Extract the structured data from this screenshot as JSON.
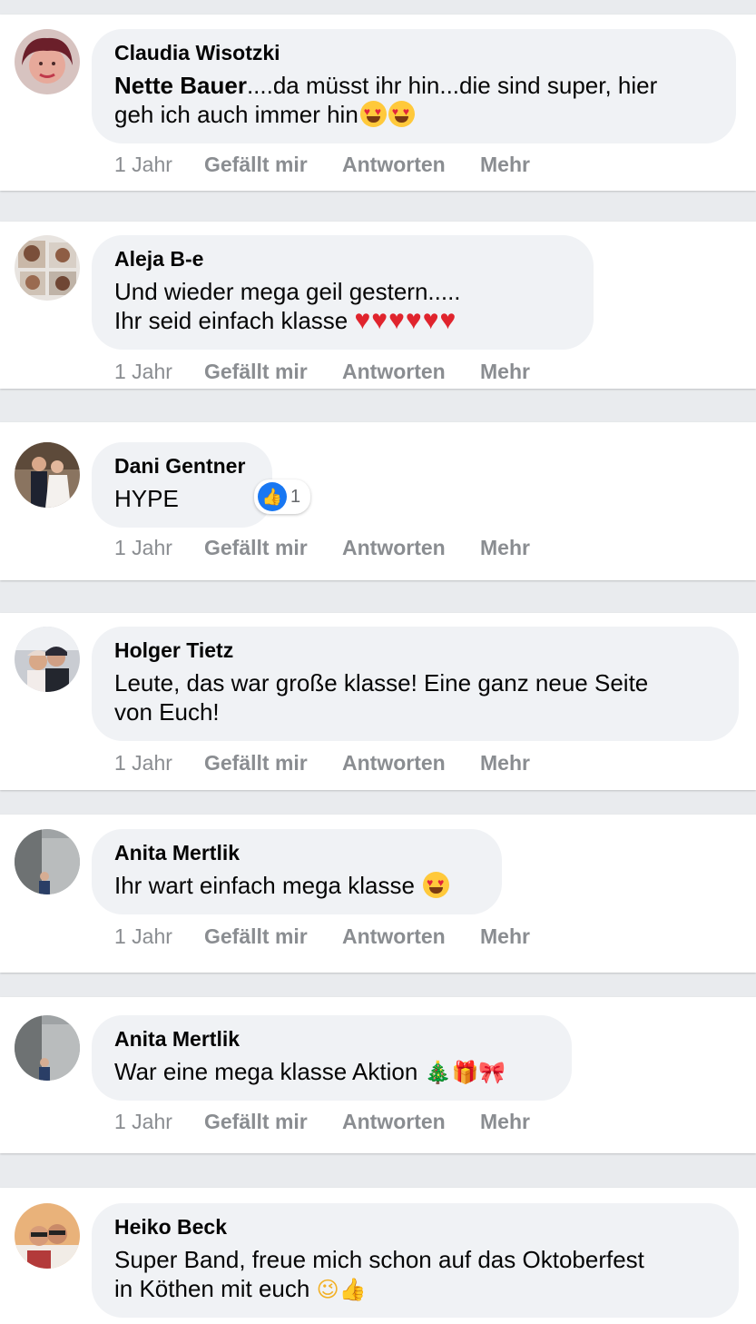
{
  "actions": {
    "time": "1 Jahr",
    "like": "Gefällt mir",
    "reply": "Antworten",
    "more": "Mehr"
  },
  "comments": [
    {
      "author": "Claudia Wisotzki",
      "mention": "Nette Bauer",
      "line1": "....da müsst ihr hin...die sind super, hier",
      "line2": "geh ich auch immer hin",
      "emoji": "heart-eyes-emoji x2"
    },
    {
      "author": "Aleja B-e",
      "line1": "Und wieder mega geil gestern.....",
      "line2": "Ihr seid einfach klasse",
      "emoji": "❤️❤️❤️❤️❤️❤️"
    },
    {
      "author": "Dani Gentner",
      "line1": "HYPE",
      "reaction_count": "1"
    },
    {
      "author": "Holger Tietz",
      "line1": "Leute, das war große klasse! Eine ganz neue Seite",
      "line2": "von Euch!"
    },
    {
      "author": "Anita Mertlik",
      "line1": "Ihr wart einfach mega klasse",
      "emoji": "heart-eyes-emoji"
    },
    {
      "author": "Anita Mertlik",
      "line1": "War eine mega klasse Aktion",
      "emoji": "🎄🎁🎀"
    },
    {
      "author": "Heiko Beck",
      "line1": "Super Band, freue mich schon auf das Oktoberfest",
      "line2": "in Köthen mit euch",
      "emoji": "😉👍"
    }
  ]
}
